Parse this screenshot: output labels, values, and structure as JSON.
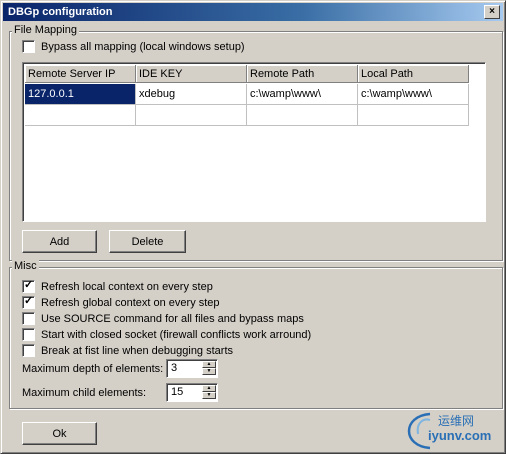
{
  "window": {
    "title": "DBGp configuration",
    "close_glyph": "×"
  },
  "file_mapping": {
    "legend": "File Mapping",
    "bypass_label": "Bypass all mapping (local windows setup)",
    "bypass_checked": false,
    "columns": [
      "Remote Server IP",
      "IDE KEY",
      "Remote Path",
      "Local Path"
    ],
    "rows": [
      [
        "127.0.0.1",
        "xdebug",
        "c:\\wamp\\www\\",
        "c:\\wamp\\www\\"
      ],
      [
        "",
        "",
        "",
        ""
      ]
    ],
    "add_label": "Add",
    "delete_label": "Delete"
  },
  "misc": {
    "legend": "Misc",
    "options": [
      {
        "label": "Refresh local context on every step",
        "checked": true
      },
      {
        "label": "Refresh global context on every step",
        "checked": true
      },
      {
        "label": "Use SOURCE command for all files and bypass maps",
        "checked": false
      },
      {
        "label": "Start with closed socket (firewall conflicts work arround)",
        "checked": false
      },
      {
        "label": "Break at fist line when debugging starts",
        "checked": false
      }
    ],
    "max_depth_label": "Maximum depth of elements:",
    "max_depth_value": "3",
    "max_children_label": "Maximum child elements:",
    "max_children_value": "15"
  },
  "ok_label": "Ok",
  "watermark": {
    "line1": "运维网",
    "line2": "iyunv.com",
    "color": "#2a6fb5"
  },
  "colors": {
    "selection": "#0a246a",
    "face": "#d4d0c8"
  }
}
